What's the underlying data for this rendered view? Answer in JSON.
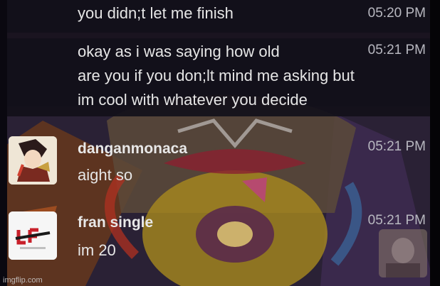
{
  "messages": [
    {
      "text": "you didn;t let me finish",
      "time": "05:20 PM"
    },
    {
      "lines": [
        "okay as i was saying how old",
        "are you if you don;lt mind me asking but",
        "im cool with whatever you decide"
      ],
      "time": "05:21 PM"
    },
    {
      "author": "danganmonaca",
      "text": "aight so",
      "time": "05:21 PM",
      "avatar_icon": "anime-character-avatar"
    },
    {
      "author": "fran single",
      "text": "im 20",
      "time": "05:21 PM",
      "avatar_icon": "logo-avatar"
    }
  ],
  "watermark": "imgflip.com",
  "colors": {
    "row_bg": "#12101a",
    "text": "#e6e6e6",
    "time": "#b8b8c0",
    "accent_red": "#c8202a"
  }
}
